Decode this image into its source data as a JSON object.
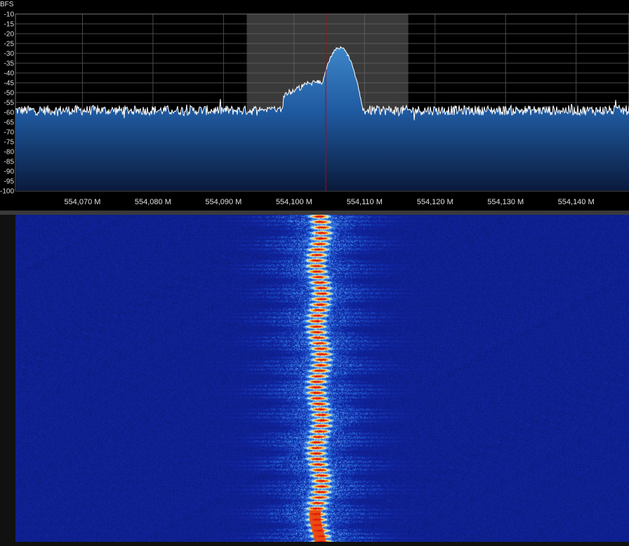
{
  "spectrum": {
    "unit_label": "BFS",
    "db_ticks": [
      "-10",
      "-15",
      "-20",
      "-25",
      "-30",
      "-35",
      "-40",
      "-45",
      "-50",
      "-55",
      "-60",
      "-65",
      "-70",
      "-75",
      "-80",
      "-85",
      "-90",
      "-95",
      "-100"
    ],
    "db_range": [
      -100,
      -10
    ],
    "freq_ticks": [
      {
        "label": "554,070 M",
        "mhz": 554.07
      },
      {
        "label": "554,080 M",
        "mhz": 554.08
      },
      {
        "label": "554,090 M",
        "mhz": 554.09
      },
      {
        "label": "554,100 M",
        "mhz": 554.1
      },
      {
        "label": "554,110 M",
        "mhz": 554.11
      },
      {
        "label": "554,120 M",
        "mhz": 554.12
      },
      {
        "label": "554,130 M",
        "mhz": 554.13
      },
      {
        "label": "554,140 M",
        "mhz": 554.14
      }
    ],
    "freq_range_mhz": [
      554.0605,
      554.1475
    ],
    "filter_band_mhz": [
      554.0933,
      554.1162
    ],
    "tuned_freq_mhz": 554.1045,
    "noise_floor_db": -59,
    "peak_freq_mhz": 554.1065,
    "peak_db": -27
  },
  "colors": {
    "background": "#000000",
    "grid": "#4a4a4a",
    "trace": "#ffffff",
    "fill_top": "#3d86c8",
    "fill_bottom": "#0a1a3c",
    "filter_band": "#6a6a6a",
    "tuned_line": "#c00000",
    "waterfall_bg": "#0a1670",
    "text": "#e0e0e0"
  }
}
